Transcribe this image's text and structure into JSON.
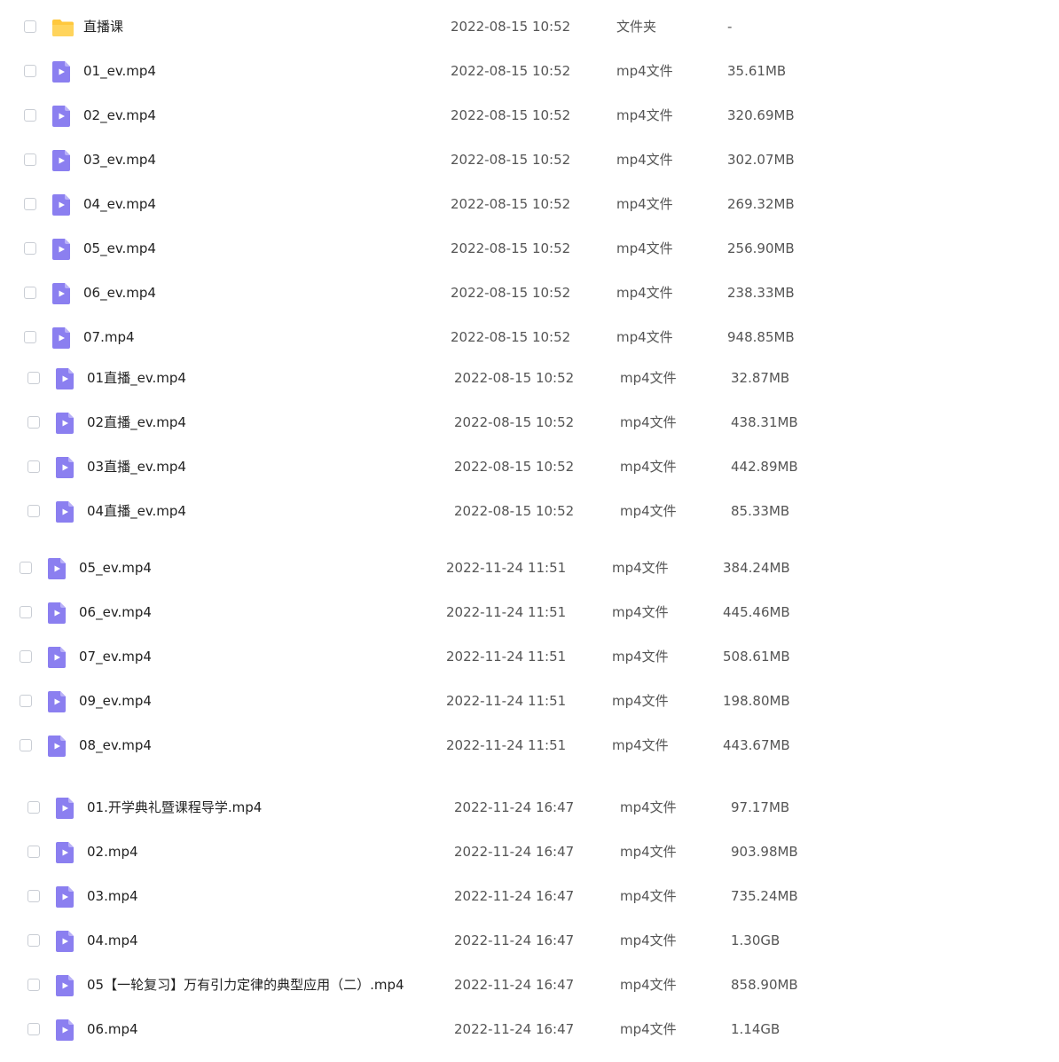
{
  "colors": {
    "folder_icon": "#ffc83d",
    "video_icon": "#8b7ff0",
    "video_icon_fold": "#b9b1f8",
    "checkbox_border": "#c9cdd4"
  },
  "icons": {
    "folder": "folder-icon",
    "video": "video-file-icon"
  },
  "groups": [
    {
      "rows": [
        {
          "icon": "folder",
          "name": "直播课",
          "date": "2022-08-15 10:52",
          "type": "文件夹",
          "size": "-"
        },
        {
          "icon": "video",
          "name": "01_ev.mp4",
          "date": "2022-08-15 10:52",
          "type": "mp4文件",
          "size": "35.61MB"
        },
        {
          "icon": "video",
          "name": "02_ev.mp4",
          "date": "2022-08-15 10:52",
          "type": "mp4文件",
          "size": "320.69MB"
        },
        {
          "icon": "video",
          "name": "03_ev.mp4",
          "date": "2022-08-15 10:52",
          "type": "mp4文件",
          "size": "302.07MB"
        },
        {
          "icon": "video",
          "name": "04_ev.mp4",
          "date": "2022-08-15 10:52",
          "type": "mp4文件",
          "size": "269.32MB"
        },
        {
          "icon": "video",
          "name": "05_ev.mp4",
          "date": "2022-08-15 10:52",
          "type": "mp4文件",
          "size": "256.90MB"
        },
        {
          "icon": "video",
          "name": "06_ev.mp4",
          "date": "2022-08-15 10:52",
          "type": "mp4文件",
          "size": "238.33MB"
        },
        {
          "icon": "video",
          "name": "07.mp4",
          "date": "2022-08-15 10:52",
          "type": "mp4文件",
          "size": "948.85MB"
        }
      ]
    },
    {
      "rows": [
        {
          "icon": "video",
          "name": "01直播_ev.mp4",
          "date": "2022-08-15 10:52",
          "type": "mp4文件",
          "size": "32.87MB"
        },
        {
          "icon": "video",
          "name": "02直播_ev.mp4",
          "date": "2022-08-15 10:52",
          "type": "mp4文件",
          "size": "438.31MB"
        },
        {
          "icon": "video",
          "name": "03直播_ev.mp4",
          "date": "2022-08-15 10:52",
          "type": "mp4文件",
          "size": "442.89MB"
        },
        {
          "icon": "video",
          "name": "04直播_ev.mp4",
          "date": "2022-08-15 10:52",
          "type": "mp4文件",
          "size": "85.33MB"
        }
      ]
    },
    {
      "rows": [
        {
          "icon": "video",
          "name": "05_ev.mp4",
          "date": "2022-11-24 11:51",
          "type": "mp4文件",
          "size": "384.24MB"
        },
        {
          "icon": "video",
          "name": "06_ev.mp4",
          "date": "2022-11-24 11:51",
          "type": "mp4文件",
          "size": "445.46MB"
        },
        {
          "icon": "video",
          "name": "07_ev.mp4",
          "date": "2022-11-24 11:51",
          "type": "mp4文件",
          "size": "508.61MB"
        },
        {
          "icon": "video",
          "name": "09_ev.mp4",
          "date": "2022-11-24 11:51",
          "type": "mp4文件",
          "size": "198.80MB"
        },
        {
          "icon": "video",
          "name": "08_ev.mp4",
          "date": "2022-11-24 11:51",
          "type": "mp4文件",
          "size": "443.67MB"
        }
      ]
    },
    {
      "rows": [
        {
          "icon": "video",
          "name": "01.开学典礼暨课程导学.mp4",
          "date": "2022-11-24 16:47",
          "type": "mp4文件",
          "size": "97.17MB"
        },
        {
          "icon": "video",
          "name": "02.mp4",
          "date": "2022-11-24 16:47",
          "type": "mp4文件",
          "size": "903.98MB"
        },
        {
          "icon": "video",
          "name": "03.mp4",
          "date": "2022-11-24 16:47",
          "type": "mp4文件",
          "size": "735.24MB"
        },
        {
          "icon": "video",
          "name": "04.mp4",
          "date": "2022-11-24 16:47",
          "type": "mp4文件",
          "size": "1.30GB"
        },
        {
          "icon": "video",
          "name": "05【一轮复习】万有引力定律的典型应用（二）.mp4",
          "date": "2022-11-24 16:47",
          "type": "mp4文件",
          "size": "858.90MB"
        },
        {
          "icon": "video",
          "name": "06.mp4",
          "date": "2022-11-24 16:47",
          "type": "mp4文件",
          "size": "1.14GB"
        }
      ]
    }
  ]
}
